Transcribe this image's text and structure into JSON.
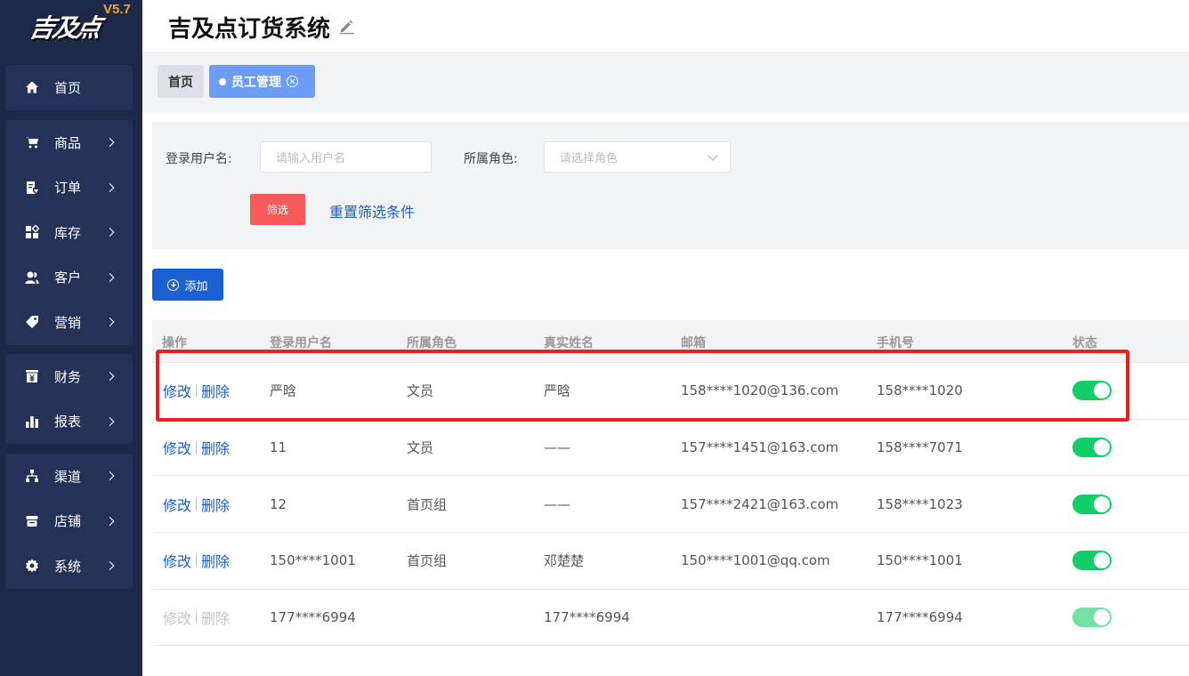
{
  "logo": {
    "text": "吉及点",
    "dots": "· · · · · · ·",
    "version": "V5.7"
  },
  "header": {
    "title": "吉及点订货系统",
    "edit_icon": "pencil-icon"
  },
  "sidebar": {
    "groups": [
      [
        {
          "label": "首页",
          "icon": "home-icon",
          "has_arrow": false
        }
      ],
      [
        {
          "label": "商品",
          "icon": "cart-icon",
          "has_arrow": true
        },
        {
          "label": "订单",
          "icon": "order-icon",
          "has_arrow": true
        },
        {
          "label": "库存",
          "icon": "inventory-icon",
          "has_arrow": true
        },
        {
          "label": "客户",
          "icon": "customer-icon",
          "has_arrow": true
        },
        {
          "label": "营销",
          "icon": "tag-icon",
          "has_arrow": true
        }
      ],
      [
        {
          "label": "财务",
          "icon": "finance-icon",
          "has_arrow": true
        },
        {
          "label": "报表",
          "icon": "chart-icon",
          "has_arrow": true
        }
      ],
      [
        {
          "label": "渠道",
          "icon": "channel-icon",
          "has_arrow": true
        },
        {
          "label": "店铺",
          "icon": "store-icon",
          "has_arrow": true
        },
        {
          "label": "系统",
          "icon": "settings-icon",
          "has_arrow": true
        }
      ]
    ]
  },
  "tabs": {
    "home": "首页",
    "active": "员工管理"
  },
  "filter": {
    "username_label": "登录用户名:",
    "username_placeholder": "请输入用户名",
    "role_label": "所属角色:",
    "role_placeholder": "请选择角色",
    "filter_button": "筛选",
    "reset_link": "重置筛选条件"
  },
  "add_button": "添加",
  "table": {
    "headers": [
      "操作",
      "登录用户名",
      "所属角色",
      "真实姓名",
      "邮箱",
      "手机号",
      "状态"
    ],
    "edit_label": "修改",
    "delete_label": "删除",
    "rows": [
      {
        "username": "严晗",
        "role": "文员",
        "real_name": "严晗",
        "email": "158****1020@136.com",
        "phone": "158****1020",
        "status_on": true,
        "disabled": false
      },
      {
        "username": "11",
        "role": "文员",
        "real_name": "——",
        "email": "157****1451@163.com",
        "phone": "158****7071",
        "status_on": true,
        "disabled": false
      },
      {
        "username": "12",
        "role": "首页组",
        "real_name": "——",
        "email": "157****2421@163.com",
        "phone": "158****1023",
        "status_on": true,
        "disabled": false
      },
      {
        "username": "150****1001",
        "role": "首页组",
        "real_name": "邓楚楚",
        "email": "150****1001@qq.com",
        "phone": "150****1001",
        "status_on": true,
        "disabled": false
      },
      {
        "username": "177****6994",
        "role": "",
        "real_name": "177****6994",
        "email": "",
        "phone": "177****6994",
        "status_on": true,
        "disabled": true
      }
    ]
  },
  "colors": {
    "sidebar_bg": "#1c2848",
    "accent_blue": "#1960d3",
    "filter_red": "#f75a5a",
    "toggle_green": "#13ce66",
    "highlight_red": "#f01d1d"
  }
}
